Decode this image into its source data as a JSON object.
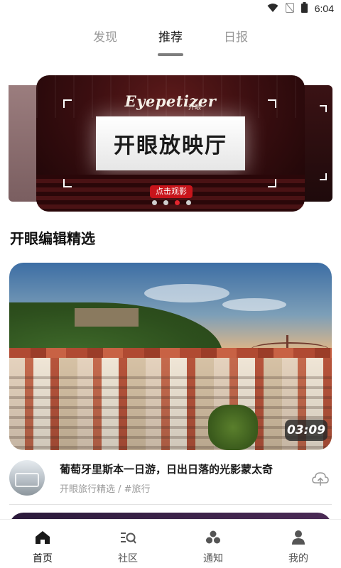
{
  "status_bar": {
    "time": "6:04",
    "icons": [
      "wifi-icon",
      "no-signal-icon",
      "battery-icon"
    ]
  },
  "top_tabs": [
    {
      "label": "发现",
      "active": false
    },
    {
      "label": "推荐",
      "active": true
    },
    {
      "label": "日报",
      "active": false
    }
  ],
  "banner": {
    "brand": "Eyepetizer",
    "brand_sub": "开眼",
    "headline": "开眼放映厅",
    "cta": "点击观影",
    "slides_total": 4,
    "active_slide": 3
  },
  "section": {
    "title": "开眼编辑精选"
  },
  "video": {
    "duration": "03:09",
    "title": "葡萄牙里斯本一日游，日出日落的光影蒙太奇",
    "meta": "开眼旅行精选 / #旅行"
  },
  "bottom_nav": [
    {
      "label": "首页",
      "icon": "home-icon",
      "active": true
    },
    {
      "label": "社区",
      "icon": "community-icon",
      "active": false
    },
    {
      "label": "通知",
      "icon": "notification-icon",
      "active": false
    },
    {
      "label": "我的",
      "icon": "profile-icon",
      "active": false
    }
  ],
  "colors": {
    "accent": "#e2262d",
    "text_primary": "#1a1a1a",
    "text_secondary": "#9a9a9a"
  }
}
